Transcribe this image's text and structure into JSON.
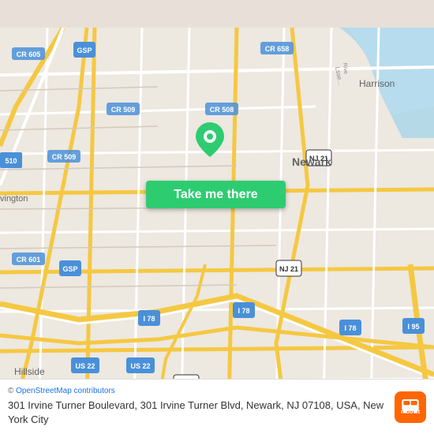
{
  "map": {
    "alt": "Map of Newark NJ area",
    "background_color": "#e8e0d8"
  },
  "cta_button": {
    "label": "Take me there",
    "bg_color": "#2ecc71"
  },
  "bottom_bar": {
    "osm_credit": "© OpenStreetMap contributors",
    "address": "301 Irvine Turner Boulevard, 301 Irvine Turner Blvd, Newark, NJ 07108, USA, New York City"
  },
  "moovit": {
    "logo_alt": "moovit"
  }
}
